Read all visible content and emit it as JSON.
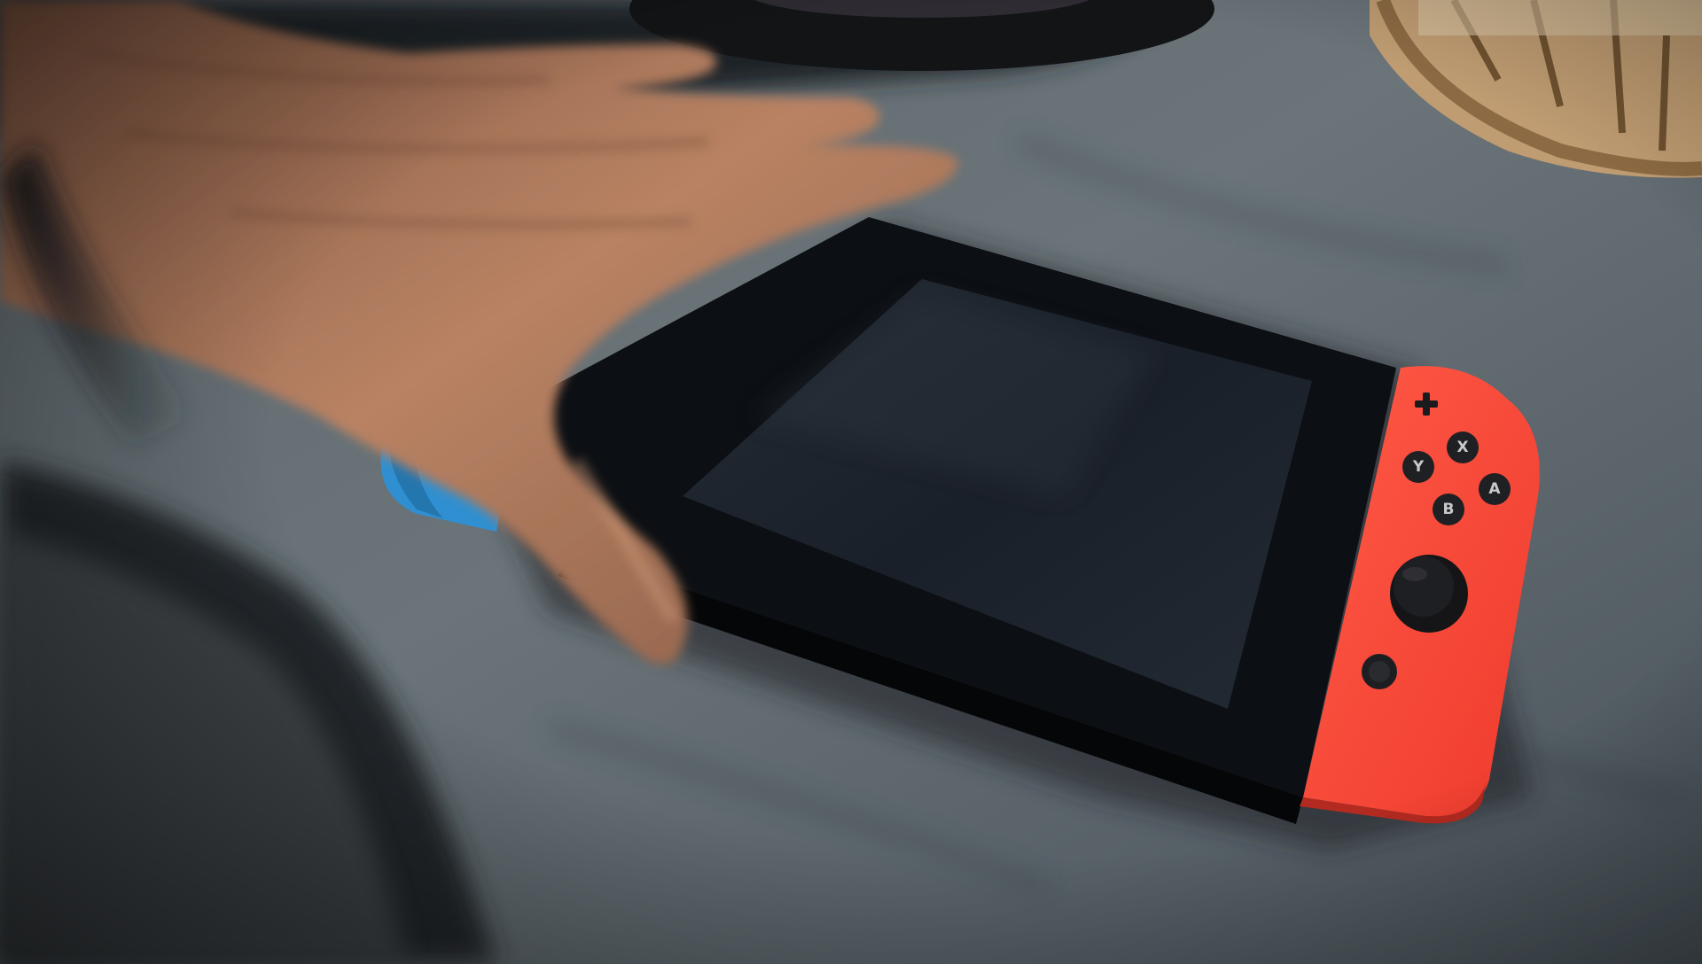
{
  "scene": {
    "subject": "handheld-console-on-table",
    "colors": {
      "left_joycon": "#2f8fd0",
      "right_joycon": "#ff4b3a",
      "console_body": "#0d1014",
      "screen": "#1b2430",
      "table_cloth": "#5a656c",
      "skin": "#b77f5f",
      "basket": "#c9a77a"
    },
    "buttons": {
      "x": "X",
      "y": "Y",
      "a": "A",
      "b": "B"
    }
  }
}
